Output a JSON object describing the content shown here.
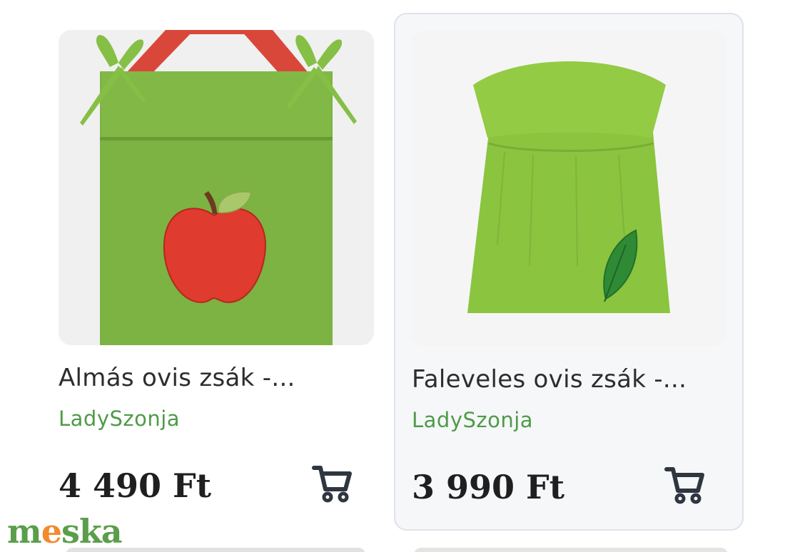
{
  "products": [
    {
      "title": "Almás ovis zsák -...",
      "seller": "LadySzonja",
      "price": "4 490 Ft",
      "image_icon": "apple-bag-image",
      "cart_icon": "cart-icon"
    },
    {
      "title": "Faleveles ovis zsák -...",
      "seller": "LadySzonja",
      "price": "3 990 Ft",
      "image_icon": "leaf-bag-image",
      "cart_icon": "cart-icon"
    }
  ],
  "logo": {
    "text_m": "m",
    "text_e": "e",
    "text_ska": "ska"
  },
  "colors": {
    "seller_green": "#4f9b48",
    "logo_green": "#5a9e4b",
    "logo_orange": "#f28a2e",
    "selected_card_border": "#dfe3e8"
  }
}
